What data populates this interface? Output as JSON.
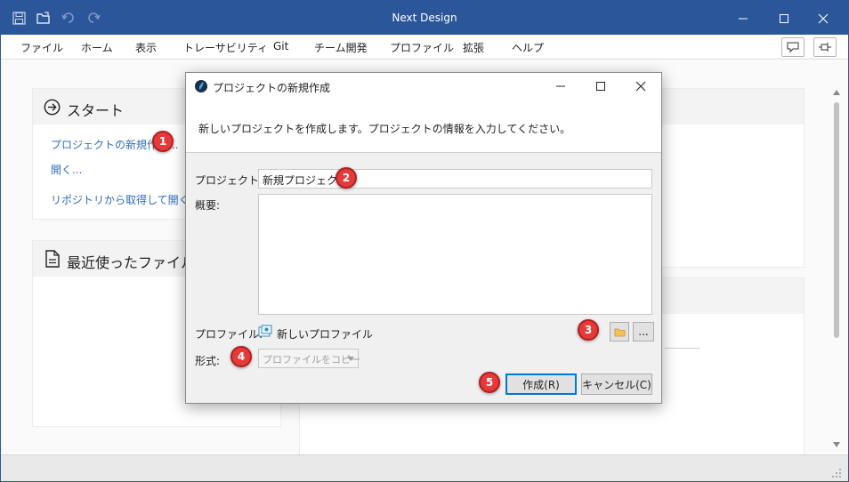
{
  "app": {
    "title": "Next Design"
  },
  "menu": {
    "items": [
      "ファイル",
      "ホーム",
      "表示",
      "トレーサビリティ",
      "Git",
      "チーム開発",
      "プロファイル",
      "拡張",
      "ヘルプ"
    ]
  },
  "start_panel": {
    "title": "スタート",
    "links": [
      "プロジェクトの新規作成...",
      "開く...",
      "リポジトリから取得して開く..."
    ]
  },
  "recent_panel": {
    "title": "最近使ったファイル"
  },
  "dialog": {
    "title": "プロジェクトの新規作成",
    "description": "新しいプロジェクトを作成します。プロジェクトの情報を入力してください。",
    "project_name_label": "プロジェクト名:",
    "project_name_value": "新規プロジェクト",
    "summary_label": "概要:",
    "summary_value": "",
    "profile_label": "プロファイル:",
    "profile_value": "新しいプロファイル",
    "format_label": "形式:",
    "format_value": "プロファイルをコピー",
    "browse_more_label": "...",
    "create_label": "作成(R)",
    "cancel_label": "キャンセル(C)"
  },
  "badges": [
    "1",
    "2",
    "3",
    "4",
    "5"
  ],
  "colors": {
    "titlebar": "#2b579a",
    "link": "#2e6cbe",
    "badge": "#e63a3a"
  },
  "icons": [
    "save-icon",
    "open-folder-icon",
    "undo-icon",
    "redo-icon",
    "minimize-icon",
    "maximize-icon",
    "close-icon",
    "comment-icon",
    "pin-icon",
    "arrow-circle-right-icon",
    "document-icon",
    "next-design-logo-icon",
    "profile-icon",
    "folder-icon",
    "chevron-down-icon"
  ]
}
